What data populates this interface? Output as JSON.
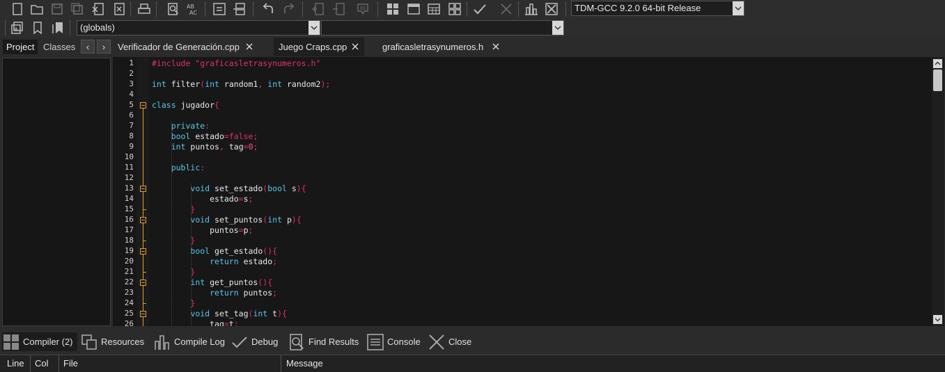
{
  "compiler_select": {
    "value": "TDM-GCC 9.2.0 64-bit Release"
  },
  "scope_select": {
    "value": "(globals)"
  },
  "member_select": {
    "value": ""
  },
  "left_tabs": [
    {
      "label": "Project"
    },
    {
      "label": "Classes"
    }
  ],
  "editor_tabs": [
    {
      "label": "Verificador de Generación.cpp"
    },
    {
      "label": "Juego Craps.cpp"
    },
    {
      "label": "graficasletrasynumeros.h"
    }
  ],
  "code_lines": [
    {
      "num": "1",
      "text": "#include \"graficasletrasynumeros.h\""
    },
    {
      "num": "2",
      "text": ""
    },
    {
      "num": "3",
      "text": "int filter(int random1, int random2);"
    },
    {
      "num": "4",
      "text": ""
    },
    {
      "num": "5",
      "text": "class jugador{"
    },
    {
      "num": "6",
      "text": ""
    },
    {
      "num": "7",
      "text": "    private:"
    },
    {
      "num": "8",
      "text": "    bool estado=false;"
    },
    {
      "num": "9",
      "text": "    int puntos, tag=0;"
    },
    {
      "num": "10",
      "text": ""
    },
    {
      "num": "11",
      "text": "    public:"
    },
    {
      "num": "12",
      "text": ""
    },
    {
      "num": "13",
      "text": "        void set_estado(bool s){"
    },
    {
      "num": "14",
      "text": "            estado=s;"
    },
    {
      "num": "15",
      "text": "        }"
    },
    {
      "num": "16",
      "text": "        void set_puntos(int p){"
    },
    {
      "num": "17",
      "text": "            puntos=p;"
    },
    {
      "num": "18",
      "text": "        }"
    },
    {
      "num": "19",
      "text": "        bool get_estado(){"
    },
    {
      "num": "20",
      "text": "            return estado;"
    },
    {
      "num": "21",
      "text": "        }"
    },
    {
      "num": "22",
      "text": "        int get_puntos(){"
    },
    {
      "num": "23",
      "text": "            return puntos;"
    },
    {
      "num": "24",
      "text": "        }"
    },
    {
      "num": "25",
      "text": "        void set_tag(int t){"
    },
    {
      "num": "26",
      "text": "            tag=t;"
    }
  ],
  "bottom_tabs": [
    {
      "label": "Compiler (2)",
      "icon": "compiler-grid-icon"
    },
    {
      "label": "Resources",
      "icon": "resources-icon"
    },
    {
      "label": "Compile Log",
      "icon": "compile-log-chart-icon"
    },
    {
      "label": "Debug",
      "icon": "debug-check-icon"
    },
    {
      "label": "Find Results",
      "icon": "find-results-icon"
    },
    {
      "label": "Console",
      "icon": "console-icon"
    },
    {
      "label": "Close",
      "icon": "close-x-icon"
    }
  ],
  "columns": [
    {
      "label": "Line"
    },
    {
      "label": "Col"
    },
    {
      "label": "File"
    },
    {
      "label": "Message"
    }
  ],
  "colors": {
    "keyword": "#58c8e8",
    "symbol": "#e0306a",
    "fold_guide": "#e0a030",
    "background": "#171717"
  }
}
